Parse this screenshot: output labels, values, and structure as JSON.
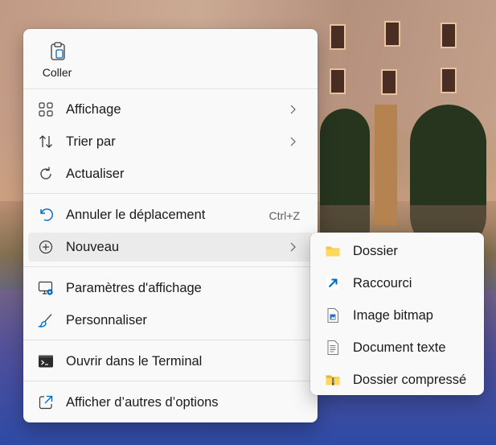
{
  "context_menu": {
    "top_actions": [
      {
        "label": "Coller",
        "icon": "clipboard-paste-icon"
      }
    ],
    "items": [
      {
        "label": "Affichage",
        "icon": "grid-view-icon",
        "submenu": true
      },
      {
        "label": "Trier par",
        "icon": "sort-icon",
        "submenu": true
      },
      {
        "label": "Actualiser",
        "icon": "refresh-icon"
      },
      {
        "label": "Annuler le déplacement",
        "icon": "undo-icon",
        "shortcut": "Ctrl+Z"
      },
      {
        "label": "Nouveau",
        "icon": "add-circle-icon",
        "submenu": true,
        "active": true
      },
      {
        "label": "Paramètres d'affichage",
        "icon": "display-settings-icon"
      },
      {
        "label": "Personnaliser",
        "icon": "brush-icon"
      },
      {
        "label": "Ouvrir dans le Terminal",
        "icon": "terminal-icon"
      },
      {
        "label": "Afficher d’autres d’options",
        "icon": "open-external-icon"
      }
    ]
  },
  "submenu_new": {
    "items": [
      {
        "label": "Dossier",
        "icon": "folder-icon"
      },
      {
        "label": "Raccourci",
        "icon": "shortcut-icon"
      },
      {
        "label": "Image bitmap",
        "icon": "bitmap-image-icon"
      },
      {
        "label": "Document texte",
        "icon": "text-document-icon"
      },
      {
        "label": "Dossier compressé",
        "icon": "zip-folder-icon"
      }
    ]
  },
  "colors": {
    "menu_bg": "#f9f9f9",
    "hover_bg": "#ebebeb",
    "accent": "#0067c0",
    "text": "#1a1a1a"
  }
}
